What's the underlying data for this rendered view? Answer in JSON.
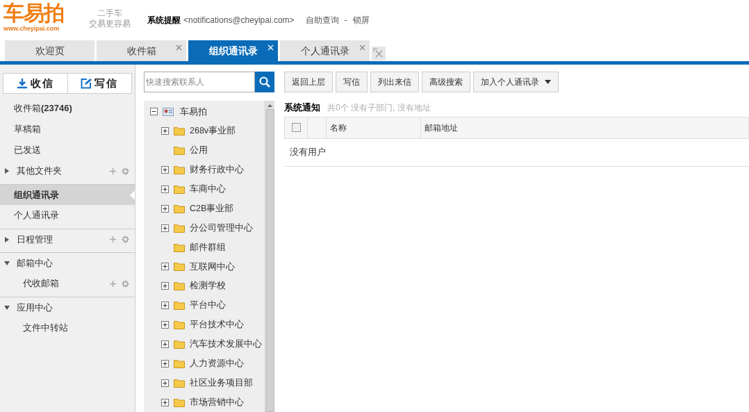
{
  "header": {
    "logo": "车易拍",
    "logo_url": "www.cheyipai.com",
    "slogan": [
      "二手车",
      "交易更容易"
    ],
    "notice_label": "系统提醒",
    "notice_email": "<notifications@cheyipai.com>",
    "links": [
      "自助查询",
      "-",
      "锁屏"
    ]
  },
  "tabs": [
    {
      "label": "欢迎页",
      "selected": false,
      "closable": false
    },
    {
      "label": "收件箱",
      "selected": false,
      "closable": true
    },
    {
      "label": "组织通讯录",
      "selected": true,
      "closable": true
    },
    {
      "label": "个人通讯录",
      "selected": false,
      "closable": true
    }
  ],
  "sidebar": {
    "buttons": [
      {
        "label": "收信",
        "kind": "receive"
      },
      {
        "label": "写信",
        "kind": "compose"
      }
    ],
    "items": [
      {
        "label": "收件箱**(23746)**",
        "kind": "item",
        "selected": false,
        "divider_before": false
      },
      {
        "label": "草稿箱",
        "kind": "item",
        "selected": false,
        "divider_before": false
      },
      {
        "label": "已发送",
        "kind": "item",
        "selected": false,
        "divider_before": false
      },
      {
        "label": "其他文件夹",
        "kind": "section",
        "expanded": false,
        "tools": true,
        "selected": false,
        "divider_before": false
      },
      {
        "label": "组织通讯录",
        "kind": "item",
        "selected": true,
        "divider_before": true
      },
      {
        "label": "个人通讯录",
        "kind": "item",
        "selected": false,
        "divider_before": false
      },
      {
        "label": "日程管理",
        "kind": "section",
        "expanded": false,
        "tools": true,
        "selected": false,
        "divider_before": true
      },
      {
        "label": "邮箱中心",
        "kind": "section",
        "expanded": true,
        "tools": false,
        "selected": false,
        "divider_before": true
      },
      {
        "label": "代收邮箱",
        "kind": "subitem",
        "tools": true,
        "selected": false,
        "divider_before": false
      },
      {
        "label": "应用中心",
        "kind": "section",
        "expanded": true,
        "tools": false,
        "selected": false,
        "divider_before": true
      },
      {
        "label": "文件中转站",
        "kind": "subitem",
        "tools": false,
        "selected": false,
        "divider_before": false
      }
    ]
  },
  "search": {
    "placeholder": "快速搜索联系人"
  },
  "tree": {
    "label": "车易拍",
    "expanded": true,
    "children": [
      {
        "label": "268v事业部",
        "kind": "branch"
      },
      {
        "label": "公用",
        "kind": "leaf"
      },
      {
        "label": "财务行政中心",
        "kind": "branch"
      },
      {
        "label": "车商中心",
        "kind": "branch"
      },
      {
        "label": "C2B事业部",
        "kind": "branch"
      },
      {
        "label": "分公司管理中心",
        "kind": "branch"
      },
      {
        "label": "邮件群组",
        "kind": "leaf"
      },
      {
        "label": "互联网中心",
        "kind": "branch"
      },
      {
        "label": "检测学校",
        "kind": "branch"
      },
      {
        "label": "平台中心",
        "kind": "branch"
      },
      {
        "label": "平台技术中心",
        "kind": "branch"
      },
      {
        "label": "汽车技术发展中心",
        "kind": "branch"
      },
      {
        "label": "人力资源中心",
        "kind": "branch"
      },
      {
        "label": "社区业务项目部",
        "kind": "branch"
      },
      {
        "label": "市场营销中心",
        "kind": "branch"
      }
    ]
  },
  "toolbar": [
    {
      "label": "返回上层",
      "kind": "button"
    },
    {
      "label": "写信",
      "kind": "button"
    },
    {
      "label": "列出来信",
      "kind": "button"
    },
    {
      "label": "高级搜索",
      "kind": "button"
    },
    {
      "label": "加入个人通讯录",
      "kind": "dropdown"
    }
  ],
  "panel": {
    "title": "系统通知",
    "info": "共0个 没有子部门, 没有地址",
    "columns": [
      "名称",
      "邮箱地址"
    ],
    "select_all": false,
    "empty": "没有用户"
  }
}
